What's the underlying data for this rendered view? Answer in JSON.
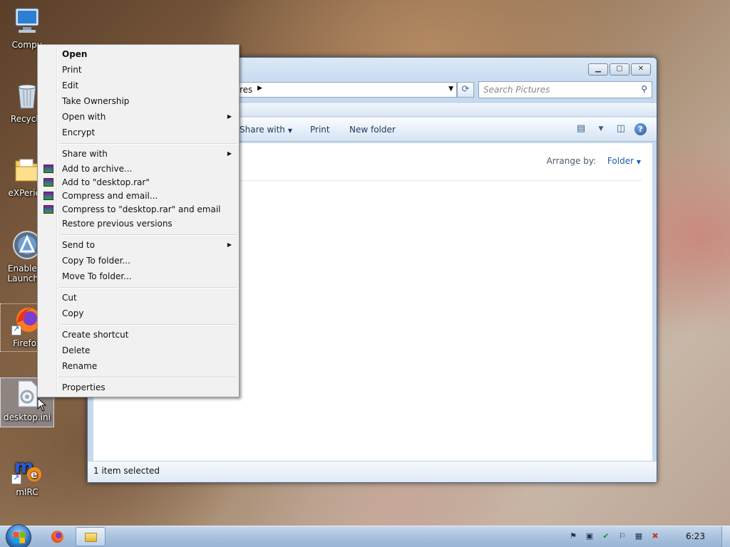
{
  "desktop_icons": [
    {
      "label": "Compu",
      "icon": "computer-icon"
    },
    {
      "label": "Recycle",
      "icon": "recycle-bin-icon"
    },
    {
      "label": "eXPerien",
      "icon": "folder-icon"
    },
    {
      "label": "Enable Q",
      "label2": "Launch...",
      "icon": "quick-launch-icon"
    },
    {
      "label": "Firefox",
      "icon": "firefox-icon"
    },
    {
      "label": "desktop.ini",
      "icon": "settings-file-icon"
    },
    {
      "label": "mIRC",
      "icon": "mirc-icon"
    }
  ],
  "explorer": {
    "breadcrumb": "res",
    "search_placeholder": "Search Pictures",
    "toolbar": {
      "share_with": "Share with",
      "print": "Print",
      "new_folder": "New folder"
    },
    "arrange_label": "Arrange by:",
    "arrange_value": "Folder",
    "status": "1 item selected"
  },
  "context_menu": {
    "items": {
      "open": "Open",
      "print": "Print",
      "edit": "Edit",
      "take_ownership": "Take Ownership",
      "open_with": "Open with",
      "encrypt": "Encrypt",
      "share_with": "Share with",
      "add_to_archive": "Add to archive...",
      "add_to_rar": "Add to \"desktop.rar\"",
      "compress_email": "Compress and email...",
      "compress_rar_email": "Compress to \"desktop.rar\" and email",
      "restore_versions": "Restore previous versions",
      "send_to": "Send to",
      "copy_to_folder": "Copy To folder...",
      "move_to_folder": "Move To folder...",
      "cut": "Cut",
      "copy": "Copy",
      "create_shortcut": "Create shortcut",
      "delete": "Delete",
      "rename": "Rename",
      "properties": "Properties"
    }
  },
  "taskbar": {
    "clock": "6:23"
  }
}
